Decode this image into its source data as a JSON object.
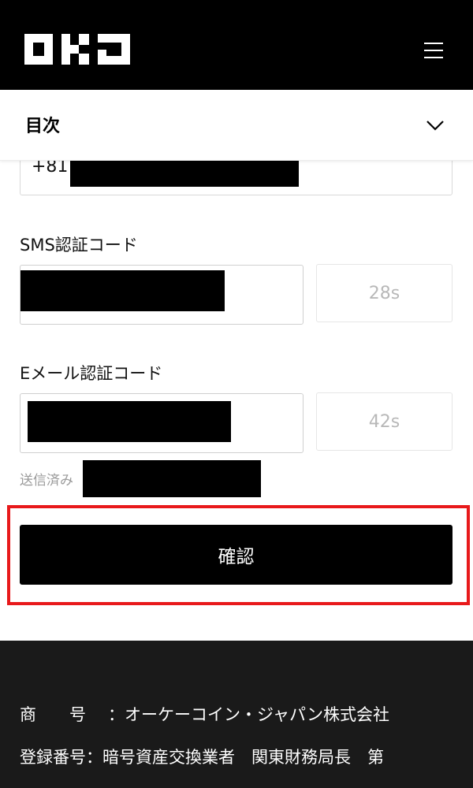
{
  "header": {
    "logo_text": "OKJ",
    "logo_icon": "okj-logo",
    "menu_icon": "hamburger-menu-icon"
  },
  "toc": {
    "title": "目次",
    "chevron_icon": "chevron-down-icon"
  },
  "phone": {
    "prefix": "+81"
  },
  "sms": {
    "label": "SMS認証コード",
    "countdown": "28s"
  },
  "email": {
    "label": "Eメール認証コード",
    "countdown": "42s",
    "sent_label": "送信済み"
  },
  "confirm": {
    "label": "確認"
  },
  "footer": {
    "company_key": "商　　号",
    "company_value": "：オーケーコイン・ジャパン株式会社",
    "registration_key": "登録番号",
    "registration_value": "：暗号資産交換業者　関東財務局長　第"
  },
  "colors": {
    "header_bg": "#000000",
    "footer_bg": "#1a1a1a",
    "highlight": "#e8191b",
    "button_bg": "#000000"
  }
}
